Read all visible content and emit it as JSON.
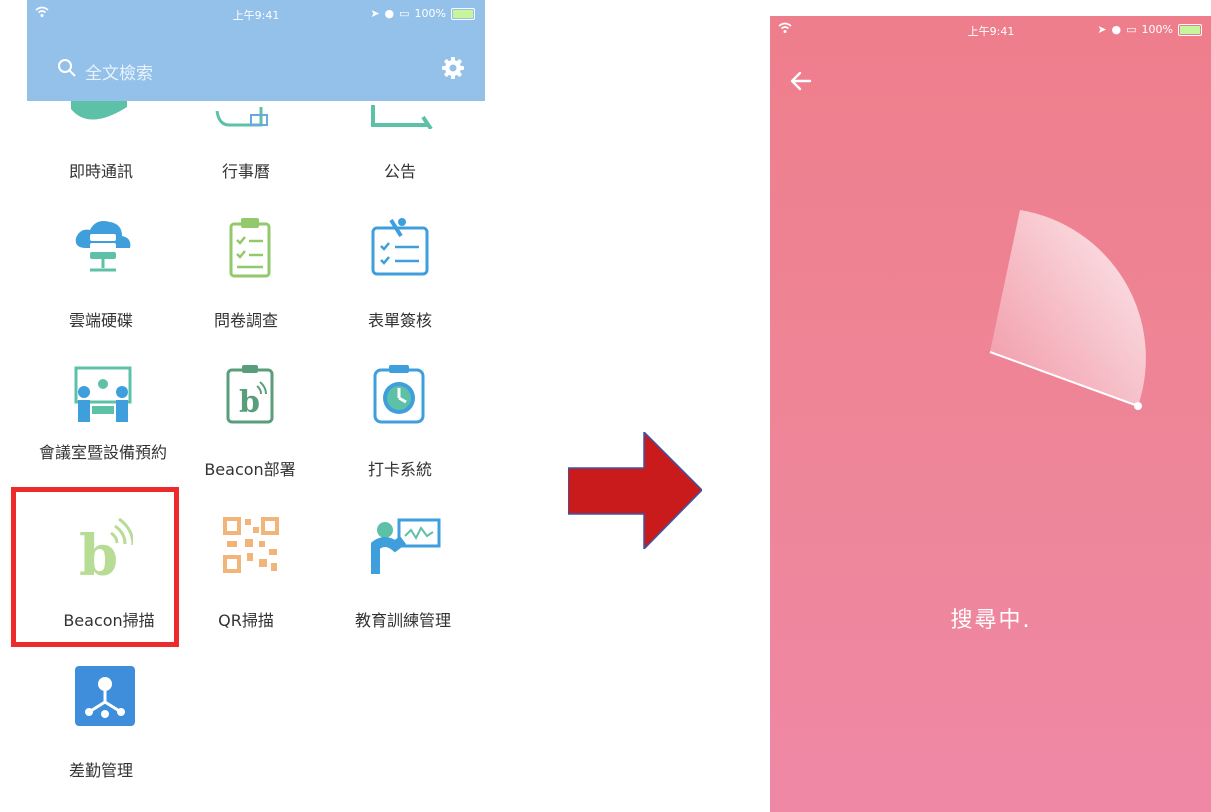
{
  "left_screen": {
    "status": {
      "time": "上午9:41",
      "battery": "100%"
    },
    "search": {
      "placeholder": "全文檢索"
    },
    "grid": {
      "row1": [
        "即時通訊",
        "行事曆",
        "公告"
      ],
      "row2": [
        "雲端硬碟",
        "問卷調查",
        "表單簽核"
      ],
      "row3_a": "會議室暨設備預約",
      "row3": [
        "Beacon部署",
        "打卡系統"
      ],
      "row4": [
        "Beacon掃描",
        "QR掃描",
        "教育訓練管理"
      ],
      "row5": [
        "差勤管理"
      ]
    },
    "icon_names": [
      "chat-icon",
      "calendar-icon",
      "announcement-icon",
      "cloud-drive-icon",
      "survey-icon",
      "form-signoff-icon",
      "meeting-room-icon",
      "beacon-deploy-icon",
      "time-clock-icon",
      "beacon-scan-icon",
      "qr-scan-icon",
      "training-icon",
      "attendance-icon"
    ],
    "highlight_color": "#ee2b2b",
    "header_color": "#93c1ea"
  },
  "right_screen": {
    "status": {
      "time": "上午9:41",
      "battery": "100%"
    },
    "searching_text": "搜尋中.",
    "background_color": "#ef82a0"
  },
  "arrow_color": "#c91b1b"
}
